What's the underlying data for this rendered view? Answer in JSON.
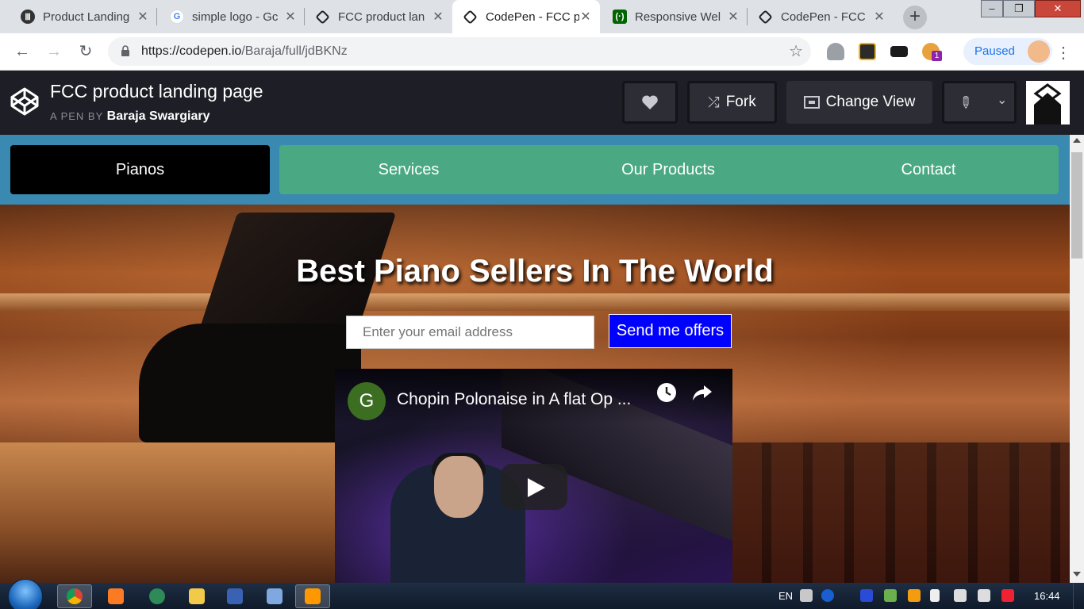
{
  "browser": {
    "tabs": [
      {
        "title": "Product Landing",
        "favicon": "piano-icon"
      },
      {
        "title": "simple logo - Gc",
        "favicon": "google-icon"
      },
      {
        "title": "FCC product lan",
        "favicon": "codepen-icon"
      },
      {
        "title": "CodePen - FCC p",
        "favicon": "codepen-icon"
      },
      {
        "title": "Responsive Wel",
        "favicon": "freecodecamp-icon"
      },
      {
        "title": "CodePen - FCC",
        "favicon": "codepen-icon"
      }
    ],
    "url_host": "https://codepen.io",
    "url_path": "/Baraja/full/jdBKNz",
    "profile_label": "Paused",
    "extension_badge": "1"
  },
  "codepen": {
    "title": "FCC product landing page",
    "by_prefix": "A PEN BY",
    "author": "Baraja Swargiary",
    "fork_label": "Fork",
    "change_view_label": "Change View"
  },
  "page": {
    "brand": "Pianos",
    "nav": [
      "Services",
      "Our Products",
      "Contact"
    ],
    "hero_title": "Best Piano Sellers In The World",
    "email_placeholder": "Enter your email address",
    "submit_label": "Send me offers",
    "video": {
      "channel_initial": "G",
      "title": "Chopin Polonaise in A flat Op ..."
    }
  },
  "taskbar": {
    "language": "EN",
    "time": "16:44"
  },
  "colors": {
    "nav_bg": "#3989b1",
    "nav_links_bg": "#4aa982",
    "brand_bg": "#000000",
    "submit_bg": "#0000ff",
    "codepen_header": "#1e1f26"
  }
}
